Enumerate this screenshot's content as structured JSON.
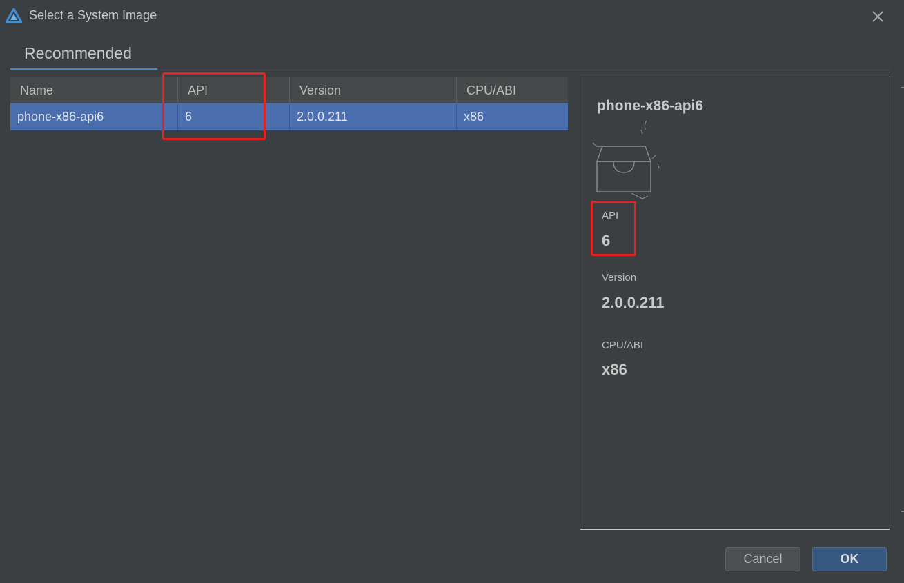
{
  "window": {
    "title": "Select a System Image",
    "icon": "harmony-logo-icon",
    "close_icon": "close-icon"
  },
  "tabs": [
    {
      "label": "Recommended",
      "active": true
    }
  ],
  "table": {
    "columns": [
      "Name",
      "API",
      "Version",
      "CPU/ABI"
    ],
    "rows": [
      {
        "name": "phone-x86-api6",
        "api": "6",
        "version": "2.0.0.211",
        "cpu_abi": "x86",
        "selected": true
      }
    ]
  },
  "details": {
    "title": "phone-x86-api6",
    "image_icon": "empty-box-icon",
    "api_label": "API",
    "api_value": "6",
    "version_label": "Version",
    "version_value": "2.0.0.211",
    "cpu_label": "CPU/ABI",
    "cpu_value": "x86"
  },
  "buttons": {
    "cancel": "Cancel",
    "ok": "OK"
  },
  "colors": {
    "background": "#3c3f41",
    "selection": "#4b6eaf",
    "accent": "#4a88c7",
    "highlight_box": "#e52323",
    "ok_button": "#365880"
  }
}
